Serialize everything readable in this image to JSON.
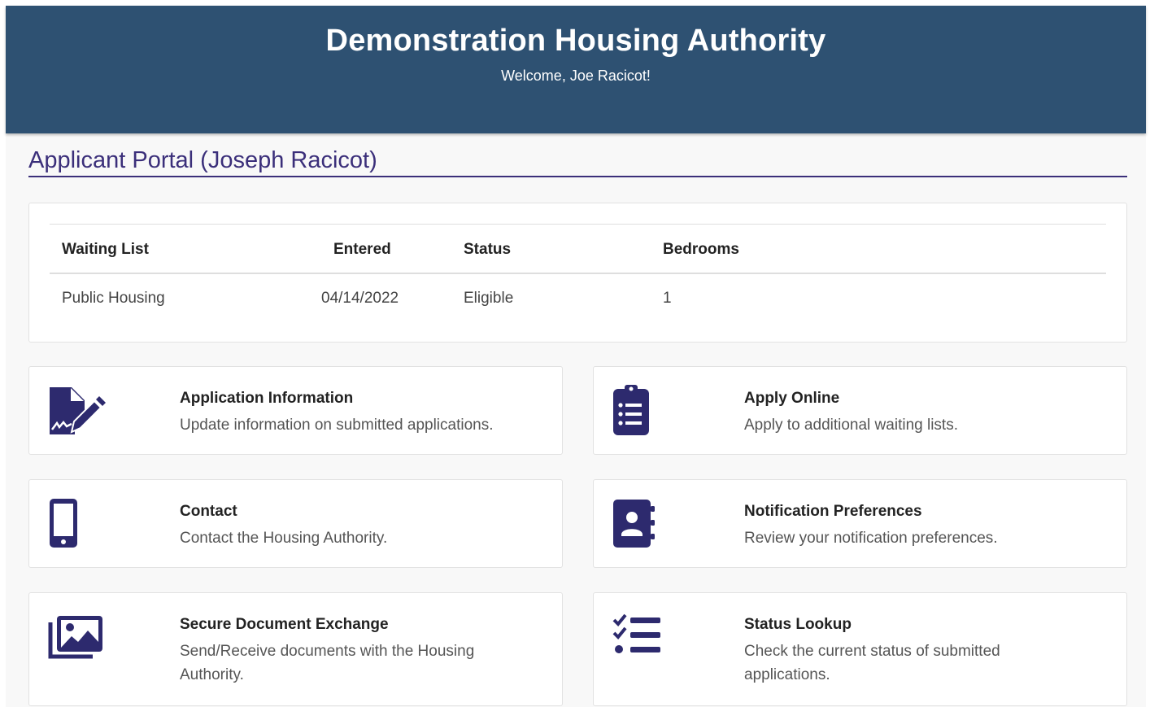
{
  "header": {
    "title": "Demonstration Housing Authority",
    "welcome": "Welcome, Joe Racicot!"
  },
  "portal": {
    "title": "Applicant Portal (Joseph Racicot)"
  },
  "waiting_table": {
    "columns": [
      "Waiting List",
      "Entered",
      "Status",
      "Bedrooms"
    ],
    "rows": [
      [
        "Public Housing",
        "04/14/2022",
        "Eligible",
        "1"
      ]
    ]
  },
  "tiles": [
    {
      "title": "Application Information",
      "desc": "Update information on submitted applications.",
      "icon": "file-signature-icon"
    },
    {
      "title": "Apply Online",
      "desc": "Apply to additional waiting lists.",
      "icon": "clipboard-list-icon"
    },
    {
      "title": "Contact",
      "desc": "Contact the Housing Authority.",
      "icon": "mobile-phone-icon"
    },
    {
      "title": "Notification Preferences",
      "desc": "Review your notification preferences.",
      "icon": "address-book-icon"
    },
    {
      "title": "Secure Document Exchange",
      "desc": "Send/Receive documents with the Housing Authority.",
      "icon": "images-icon"
    },
    {
      "title": "Status Lookup",
      "desc": "Check the current status of submitted applications.",
      "icon": "tasks-list-icon"
    }
  ],
  "colors": {
    "header_bg": "#2e5172",
    "accent": "#3b2f7a",
    "icon": "#2d2a6e"
  }
}
